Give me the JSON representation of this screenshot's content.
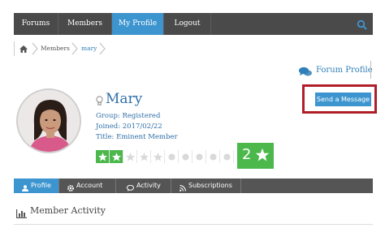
{
  "nav": {
    "items": [
      {
        "label": "Forums"
      },
      {
        "label": "Members"
      },
      {
        "label": "My Profile"
      },
      {
        "label": "Logout"
      }
    ],
    "active_color": "#3d95cf",
    "bar_color": "#4a4a4a"
  },
  "breadcrumb": {
    "items": [
      {
        "label": "Members"
      },
      {
        "label": "mary"
      }
    ]
  },
  "forum_profile": {
    "label": "Forum Profile",
    "icon": "comments-icon"
  },
  "actions": {
    "send_message": "Send a Message"
  },
  "profile": {
    "name": "Mary",
    "group": "Group: Registered",
    "joined": "Joined: 2017/02/22",
    "title": "Title: Eminent Member"
  },
  "rating": {
    "earned": 2,
    "total": 10,
    "count": "2"
  },
  "tabs": [
    {
      "label": "Profile",
      "icon": "user-icon"
    },
    {
      "label": "Account",
      "icon": "gear-icon"
    },
    {
      "label": "Activity",
      "icon": "comment-icon"
    },
    {
      "label": "Subscriptions",
      "icon": "rss-icon"
    }
  ],
  "section": {
    "title": "Member Activity",
    "icon": "bar-chart-icon"
  },
  "colors": {
    "accent": "#3d95cf",
    "highlight": "#b01e2a",
    "rating_green": "#4cb84c"
  }
}
